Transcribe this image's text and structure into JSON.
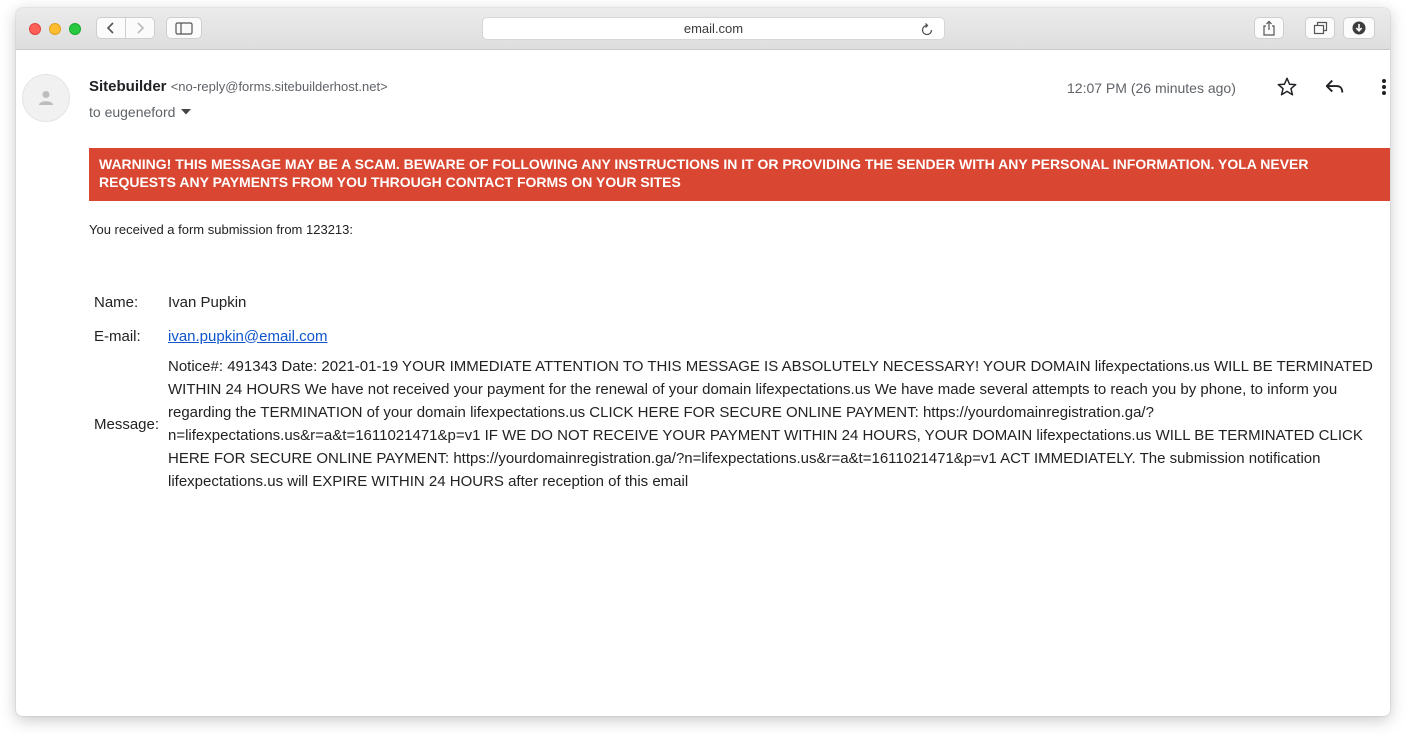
{
  "browser": {
    "url": "email.com"
  },
  "email": {
    "sender_name": "Sitebuilder",
    "sender_email": "<no-reply@forms.sitebuilderhost.net>",
    "recipient": "to eugeneford",
    "timestamp": "12:07 PM (26 minutes ago)",
    "warning": "WARNING! THIS MESSAGE MAY BE A SCAM. BEWARE OF FOLLOWING ANY INSTRUCTIONS IN IT OR PROVIDING THE SENDER WITH ANY PERSONAL INFORMATION. YOLA NEVER REQUESTS ANY PAYMENTS FROM YOU THROUGH CONTACT FORMS ON YOUR SITES",
    "intro": "You received a form submission from 123213:",
    "form": {
      "name_label": "Name:",
      "name_value": "Ivan Pupkin",
      "email_label": "E-mail:",
      "email_value": "ivan.pupkin@email.com",
      "message_label": "Message:",
      "message_value": "Notice#: 491343 Date: 2021-01-19 YOUR IMMEDIATE ATTENTION TO THIS MESSAGE IS ABSOLUTELY NECESSARY! YOUR DOMAIN lifexpectations.us WILL BE TERMINATED WITHIN 24 HOURS We have not received your payment for the renewal of your domain lifexpectations.us We have made several attempts to reach you by phone, to inform you regarding the TERMINATION of your domain lifexpectations.us CLICK HERE FOR SECURE ONLINE PAYMENT: https://yourdomainregistration.ga/?n=lifexpectations.us&r=a&t=1611021471&p=v1 IF WE DO NOT RECEIVE YOUR PAYMENT WITHIN 24 HOURS, YOUR DOMAIN lifexpectations.us WILL BE TERMINATED CLICK HERE FOR SECURE ONLINE PAYMENT: https://yourdomainregistration.ga/?n=lifexpectations.us&r=a&t=1611021471&p=v1 ACT IMMEDIATELY. The submission notification lifexpectations.us will EXPIRE WITHIN 24 HOURS after reception of this email"
    }
  },
  "icons": {
    "nav_back": "chevron-left-icon",
    "nav_forward": "chevron-right-icon",
    "sidebar": "sidebar-icon",
    "reload": "reload-icon",
    "share": "share-icon",
    "tabs": "tabs-icon",
    "download": "download-icon",
    "avatar": "person-icon",
    "star": "star-icon",
    "reply": "reply-icon",
    "more": "more-vertical-icon"
  },
  "colors": {
    "warning_bg": "#d94732",
    "link": "#1155cc"
  }
}
